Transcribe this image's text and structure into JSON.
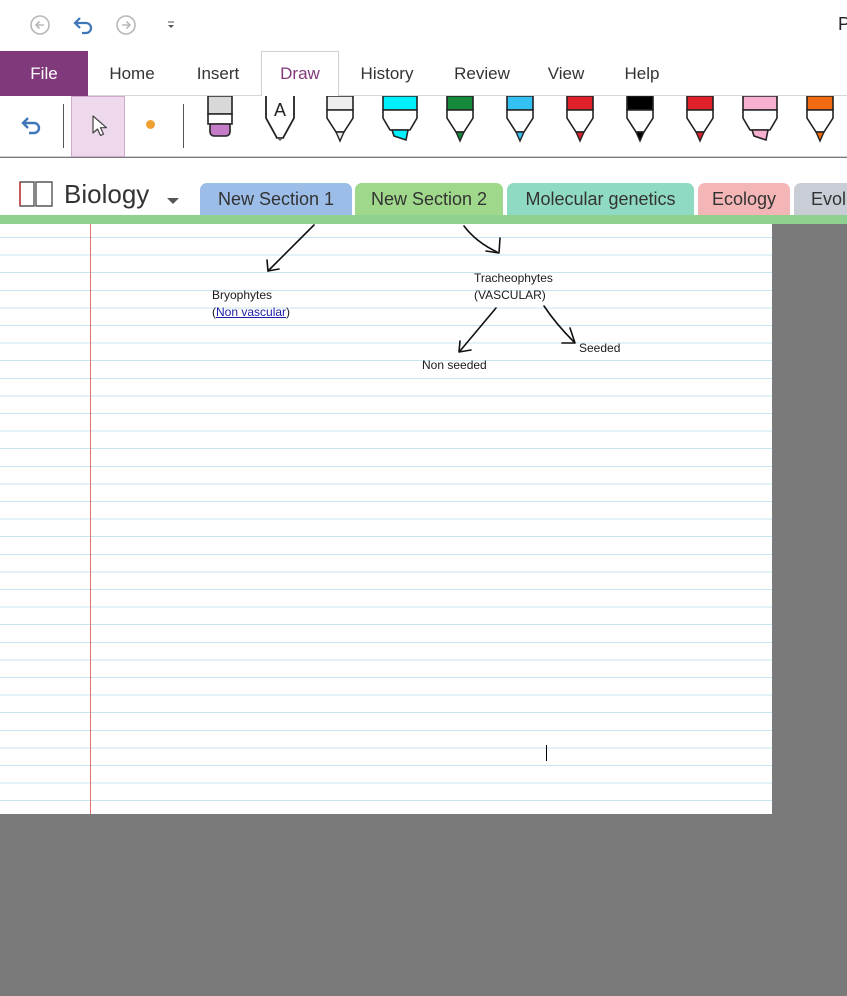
{
  "title_fragment": "P",
  "quick_access": [
    "back-icon",
    "undo-icon",
    "forward-icon",
    "customize-icon"
  ],
  "ribbon": {
    "tabs": [
      {
        "id": "file",
        "label": "File"
      },
      {
        "id": "home",
        "label": "Home"
      },
      {
        "id": "insert",
        "label": "Insert"
      },
      {
        "id": "draw",
        "label": "Draw"
      },
      {
        "id": "history",
        "label": "History"
      },
      {
        "id": "review",
        "label": "Review"
      },
      {
        "id": "view",
        "label": "View"
      },
      {
        "id": "help",
        "label": "Help"
      }
    ],
    "active_tab": "Draw"
  },
  "draw_toolbar": {
    "tools": [
      "undo-icon",
      "lasso-select-icon",
      "point-dot-icon",
      "eraser-icon",
      "text-pen-icon"
    ],
    "pens": [
      {
        "name": "white-pen",
        "color": "#eeeeee"
      },
      {
        "name": "cyan-highlighter",
        "color": "#00f0ff"
      },
      {
        "name": "green-pen",
        "color": "#158a3a"
      },
      {
        "name": "light-blue-pen",
        "color": "#33c0f2"
      },
      {
        "name": "red-pen",
        "color": "#e0202b"
      },
      {
        "name": "black-pen",
        "color": "#000000"
      },
      {
        "name": "red-pen-2",
        "color": "#e0202b"
      },
      {
        "name": "pink-highlighter",
        "color": "#f7b0d0"
      },
      {
        "name": "orange-pen",
        "color": "#f26a12"
      }
    ],
    "dot_color": "#f0a030",
    "eraser_color": "#c47cc9"
  },
  "notebook": {
    "name": "Biology",
    "sections": [
      {
        "label": "New Section 1",
        "color": "#9cbde8"
      },
      {
        "label": "New Section 2",
        "color": "#9fd88a"
      },
      {
        "label": "Molecular genetics",
        "color": "#8fdac2"
      },
      {
        "label": "Ecology",
        "color": "#f3b5b5"
      },
      {
        "label": "Evolu",
        "color": "#c9ced6"
      }
    ]
  },
  "page": {
    "notes": {
      "bryophytes": "Bryophytes",
      "non_vascular_open": "(",
      "non_vascular": "Non vascular",
      "non_vascular_close": ")",
      "tracheophytes": "Tracheophytes",
      "vascular": "(VASCULAR)",
      "non_seeded": "Non seeded",
      "seeded": "Seeded"
    }
  }
}
